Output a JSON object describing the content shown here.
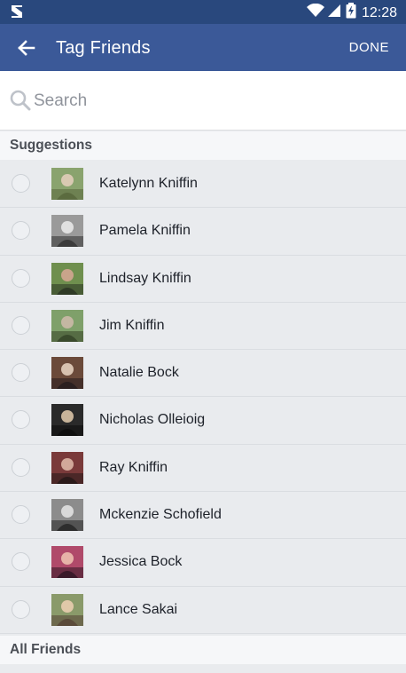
{
  "status_bar": {
    "time": "12:28"
  },
  "app_bar": {
    "title": "Tag Friends",
    "done_label": "DONE"
  },
  "search": {
    "placeholder": "Search",
    "value": ""
  },
  "sections": {
    "suggestions": "Suggestions",
    "all_friends": "All Friends"
  },
  "friends": [
    {
      "name": "Katelynn Kniffin",
      "avatar_colors": [
        "#8aa36e",
        "#d9c9b2",
        "#5b6b3f"
      ]
    },
    {
      "name": "Pamela Kniffin",
      "avatar_colors": [
        "#9a9a9a",
        "#e0e0e0",
        "#3b3b3b"
      ]
    },
    {
      "name": "Lindsay Kniffin",
      "avatar_colors": [
        "#6f8f4e",
        "#c9a48a",
        "#2f3a26"
      ]
    },
    {
      "name": "Jim Kniffin",
      "avatar_colors": [
        "#7fa06a",
        "#c4b7a2",
        "#3a4a2c"
      ]
    },
    {
      "name": "Natalie Bock",
      "avatar_colors": [
        "#6b4a3a",
        "#d8c2b0",
        "#2b2020"
      ]
    },
    {
      "name": "Nicholas Olleioig",
      "avatar_colors": [
        "#2a2a2a",
        "#c8b49a",
        "#0f0f0f"
      ]
    },
    {
      "name": "Ray Kniffin",
      "avatar_colors": [
        "#7a3a3a",
        "#d2a89a",
        "#2b1a1a"
      ]
    },
    {
      "name": "Mckenzie Schofield",
      "avatar_colors": [
        "#8c8c8c",
        "#d9d9d9",
        "#2d2d2d"
      ]
    },
    {
      "name": "Jessica Bock",
      "avatar_colors": [
        "#b04a6a",
        "#e7b3a8",
        "#3a1a2a"
      ]
    },
    {
      "name": "Lance Sakai",
      "avatar_colors": [
        "#8a9a6a",
        "#e0c8a8",
        "#5a4a3a"
      ]
    }
  ]
}
